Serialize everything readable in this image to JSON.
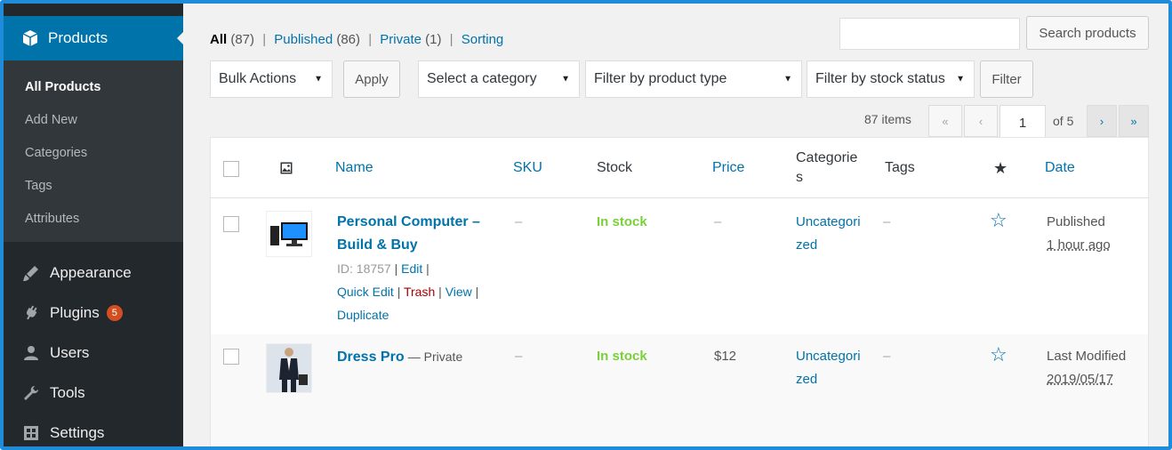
{
  "sidebar": {
    "top_item": "Products",
    "submenu": [
      "All Products",
      "Add New",
      "Categories",
      "Tags",
      "Attributes"
    ],
    "menu": [
      {
        "label": "Appearance",
        "icon": "brush-icon"
      },
      {
        "label": "Plugins",
        "icon": "plugin-icon",
        "badge": "5"
      },
      {
        "label": "Users",
        "icon": "users-icon"
      },
      {
        "label": "Tools",
        "icon": "wrench-icon"
      },
      {
        "label": "Settings",
        "icon": "settings-icon"
      }
    ]
  },
  "views": {
    "all": "All",
    "all_count": "(87)",
    "published": "Published",
    "published_count": "(86)",
    "private": "Private",
    "private_count": "(1)",
    "sorting": "Sorting",
    "separator": "|"
  },
  "search": {
    "button": "Search products",
    "value": ""
  },
  "filters": {
    "bulk_actions": "Bulk Actions",
    "apply": "Apply",
    "category": "Select a category",
    "product_type": "Filter by product type",
    "stock_status": "Filter by stock status",
    "filter": "Filter",
    "arrow": "▼"
  },
  "pagination": {
    "items": "87 items",
    "first": "«",
    "prev": "‹",
    "current_page": "1",
    "of": "of 5",
    "next": "›",
    "last": "»"
  },
  "table": {
    "headers": {
      "name": "Name",
      "sku": "SKU",
      "stock": "Stock",
      "price": "Price",
      "categories_line1": "Categorie",
      "categories_line2": "s",
      "tags": "Tags",
      "featured": "★",
      "date": "Date"
    },
    "rows": [
      {
        "name_line1": "Personal Computer –",
        "name_line2": "Build & Buy",
        "id": "ID: 18757",
        "actions": {
          "edit": "Edit",
          "quick_edit": "Quick Edit",
          "trash": "Trash",
          "view": "View",
          "duplicate": "Duplicate"
        },
        "sku": "–",
        "stock": "In stock",
        "price": "–",
        "category_line1": "Uncategori",
        "category_line2": "zed",
        "tags": "–",
        "featured_icon": "☆",
        "date_status": "Published",
        "date_value": "1 hour ago"
      },
      {
        "name": "Dress Pro",
        "suffix": "— Private",
        "sku": "–",
        "stock": "In stock",
        "price": "$12",
        "category_line1": "Uncategori",
        "category_line2": "zed",
        "tags": "–",
        "featured_icon": "☆",
        "date_status": "Last Modified",
        "date_value": "2019/05/17"
      }
    ]
  },
  "colors": {
    "accent": "#0073aa",
    "sidebar_bg": "#23282d",
    "submenu_bg": "#32373c",
    "instock": "#7ad03a",
    "trash": "#aa0000",
    "frame": "#1e8cd8"
  }
}
